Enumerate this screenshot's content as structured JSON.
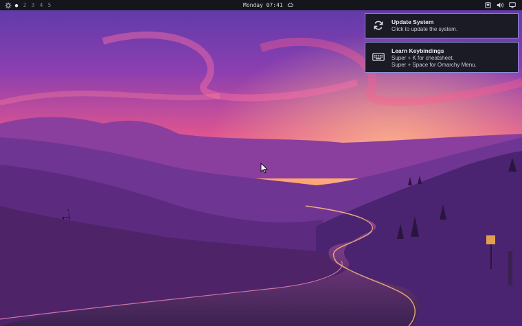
{
  "topbar": {
    "workspaces": [
      {
        "label": "●",
        "active": true
      },
      {
        "label": "2",
        "active": false
      },
      {
        "label": "3",
        "active": false
      },
      {
        "label": "4",
        "active": false
      },
      {
        "label": "5",
        "active": false
      }
    ],
    "clock": "Monday 07:41",
    "tray_icons": [
      "screen-record-icon",
      "volume-icon",
      "monitor-icon"
    ]
  },
  "notifications": [
    {
      "title": "Update System",
      "body_lines": [
        "Click to update the system."
      ],
      "icon": "refresh-icon"
    },
    {
      "title": "Learn Keybindings",
      "body_lines": [
        "Super + K for cheatsheet.",
        "Super + Space for Omarchy Menu."
      ],
      "icon": "keyboard-icon"
    }
  ],
  "colors": {
    "bar_bg": "#15161b",
    "notif_bg": "#1a1b24",
    "notif_border": "#8a8fd6"
  }
}
